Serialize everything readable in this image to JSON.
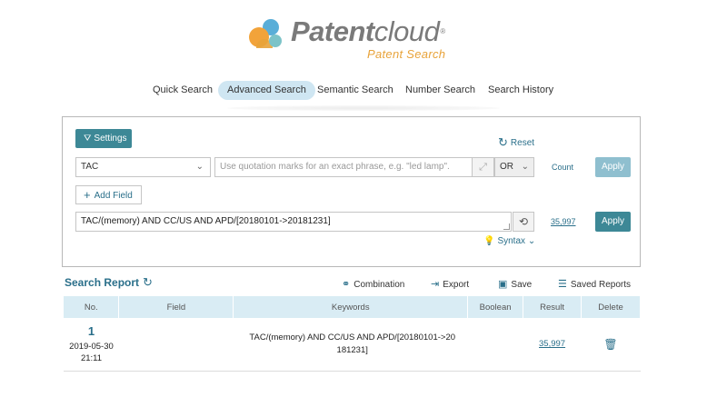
{
  "brand": {
    "name_part1": "Patent",
    "name_part2": "cloud",
    "registered": "®",
    "subtitle": "Patent Search",
    "colors": {
      "logo_blue": "#5aaed8",
      "logo_orange": "#f2a33a",
      "logo_teal": "#7cc3c8",
      "text_gray": "#7a7a7a"
    }
  },
  "tabs": [
    {
      "label": "Quick Search",
      "active": false
    },
    {
      "label": "Advanced Search",
      "active": true
    },
    {
      "label": "Semantic Search",
      "active": false
    },
    {
      "label": "Number Search",
      "active": false
    },
    {
      "label": "Search History",
      "active": false
    }
  ],
  "search_panel": {
    "settings_label": "Settings",
    "reset_label": "Reset",
    "field_select": {
      "value": "TAC"
    },
    "keyword_input": {
      "placeholder": "Use quotation marks for an exact phrase, e.g. \"led lamp\"."
    },
    "operator_select": {
      "value": "OR"
    },
    "count_label": "Count",
    "apply_label": "Apply",
    "add_field_label": "Add Field",
    "query_value": "TAC/(memory) AND CC/US AND APD/[20180101->20181231]",
    "result_count": "35,997",
    "apply2_label": "Apply",
    "syntax_label": "Syntax"
  },
  "report": {
    "title": "Search Report",
    "actions": {
      "combination": "Combination",
      "export": "Export",
      "save": "Save",
      "saved_reports": "Saved Reports"
    },
    "columns": [
      "No.",
      "Field",
      "Keywords",
      "Boolean",
      "Result",
      "Delete"
    ],
    "rows": [
      {
        "no": "1",
        "date": "2019-05-30",
        "time": "21:11",
        "field": "",
        "keywords_line1": "TAC/(memory) AND CC/US AND APD/[20180101->20",
        "keywords_line2": "181231]",
        "boolean": "",
        "result": "35,997"
      }
    ]
  },
  "icons": {
    "settings": "filter-icon",
    "reset": "refresh-icon",
    "expand": "expand-icon",
    "history": "history-icon",
    "syntax": "lightbulb-icon",
    "report_refresh": "refresh-icon",
    "combination": "combination-icon",
    "export": "export-icon",
    "save": "save-icon",
    "saved_reports": "list-icon",
    "delete": "trash-icon"
  },
  "accent_color": "#3d8896"
}
